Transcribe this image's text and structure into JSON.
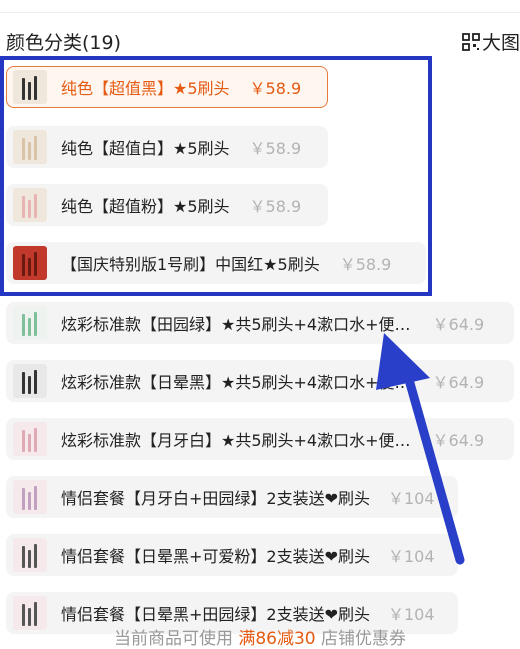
{
  "header": {
    "title": "颜色分类(19)",
    "bigpic_label": "大图"
  },
  "options": [
    {
      "label": "纯色【超值黑】★5刷头",
      "price": "￥58.9",
      "selected": true,
      "thumb_color": "#efe6dc",
      "bristle_color": "#333333"
    },
    {
      "label": "纯色【超值白】★5刷头",
      "price": "￥58.9",
      "selected": false,
      "thumb_color": "#efe6dc",
      "bristle_color": "#d9c2a8"
    },
    {
      "label": "纯色【超值粉】★5刷头",
      "price": "￥58.9",
      "selected": false,
      "thumb_color": "#efe6dc",
      "bristle_color": "#e8b3b3"
    },
    {
      "label": "【国庆特别版1号刷】中国红★5刷头",
      "price": "￥58.9",
      "selected": false,
      "thumb_color": "#c0392b",
      "bristle_color": "#6b1a12"
    },
    {
      "label": "炫彩标准款【田园绿】★共5刷头+4漱口水+便…",
      "price": "￥64.9",
      "selected": false,
      "thumb_color": "#eef3ef",
      "bristle_color": "#7fbf9a"
    },
    {
      "label": "炫彩标准款【日晕黑】★共5刷头+4漱口水+便…",
      "price": "￥64.9",
      "selected": false,
      "thumb_color": "#e8e8e8",
      "bristle_color": "#333333"
    },
    {
      "label": "炫彩标准款【月牙白】★共5刷头+4漱口水+便…",
      "price": "￥64.9",
      "selected": false,
      "thumb_color": "#f6e9ec",
      "bristle_color": "#e0aab5"
    },
    {
      "label": "情侣套餐【月牙白+田园绿】2支装送❤刷头",
      "price": "￥104",
      "selected": false,
      "thumb_color": "#f6e9ec",
      "bristle_color": "#c2a0c0"
    },
    {
      "label": "情侣套餐【日晕黑+可爱粉】2支装送❤刷头",
      "price": "￥104",
      "selected": false,
      "thumb_color": "#f6e9ec",
      "bristle_color": "#555555"
    },
    {
      "label": "情侣套餐【日晕黑+田园绿】2支装送❤刷头",
      "price": "￥104",
      "selected": false,
      "thumb_color": "#f6e9ec",
      "bristle_color": "#555555"
    }
  ],
  "promo": {
    "prefix": "当前商品可使用",
    "highlight": "满86减30",
    "suffix": "店铺优惠券"
  }
}
